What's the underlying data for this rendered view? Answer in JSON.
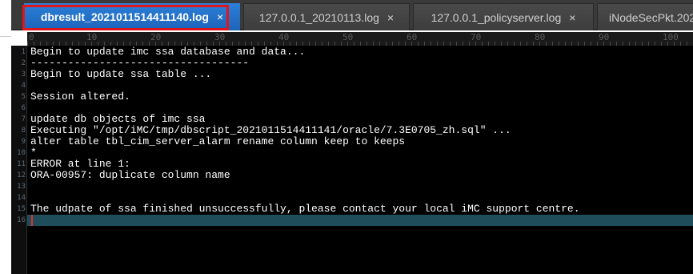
{
  "tabs": [
    {
      "label": "dbresult_2021011514411140.log",
      "close": "×",
      "active": true
    },
    {
      "label": "127.0.0.1_20210113.log",
      "close": "×",
      "active": false
    },
    {
      "label": "127.0.0.1_policyserver.log",
      "close": "×",
      "active": false
    },
    {
      "label": "iNodeSecPkt.202",
      "close": "",
      "active": false
    }
  ],
  "ruler": {
    "marks": [
      "0",
      "10",
      "20",
      "30",
      "40",
      "50",
      "60",
      "70",
      "80",
      "90",
      "100"
    ]
  },
  "lines": [
    {
      "n": "1",
      "text": "Begin to update imc ssa database and data..."
    },
    {
      "n": "2",
      "text": "-----------------------------------"
    },
    {
      "n": "3",
      "text": "Begin to update ssa table ..."
    },
    {
      "n": "4",
      "text": ""
    },
    {
      "n": "5",
      "text": "Session altered."
    },
    {
      "n": "6",
      "text": ""
    },
    {
      "n": "7",
      "text": "update db objects of imc ssa"
    },
    {
      "n": "8",
      "text": "Executing \"/opt/iMC/tmp/dbscript_2021011514411141/oracle/7.3E0705_zh.sql\" ..."
    },
    {
      "n": "9",
      "text": "alter table tbl_cim_server_alarm rename column keep to keeps"
    },
    {
      "n": "10",
      "text": "*"
    },
    {
      "n": "11",
      "text": "ERROR at line 1:"
    },
    {
      "n": "12",
      "text": "ORA-00957: duplicate column name"
    },
    {
      "n": "13",
      "text": ""
    },
    {
      "n": "14",
      "text": ""
    },
    {
      "n": "15",
      "text": "The udpate of ssa finished unsuccessfully, please contact your local iMC support centre."
    },
    {
      "n": "16",
      "text": ""
    }
  ],
  "colors": {
    "active_tab": "#1d64b9",
    "highlight": "#e0161b",
    "current_line": "#1f4d5a",
    "caret": "#e03030"
  }
}
